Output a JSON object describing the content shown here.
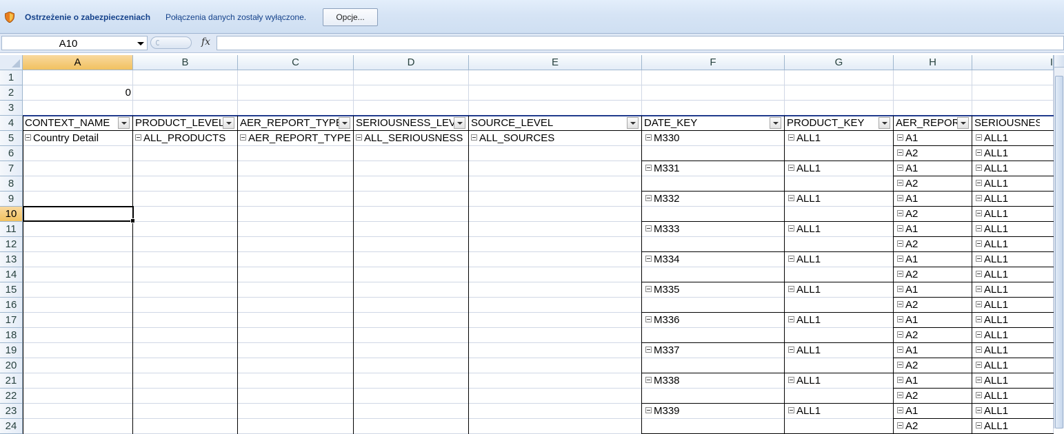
{
  "security_bar": {
    "title": "Ostrzeżenie o zabezpieczeniach",
    "message": "Połączenia danych zostały wyłączone.",
    "options_button": "Opcje..."
  },
  "formula_bar": {
    "name_box": "A10",
    "fx_label": "fx",
    "formula": ""
  },
  "columns": [
    "A",
    "B",
    "C",
    "D",
    "E",
    "F",
    "G",
    "H",
    "I"
  ],
  "rows": [
    "1",
    "2",
    "3",
    "4",
    "5",
    "6",
    "7",
    "8",
    "9",
    "10",
    "11",
    "12",
    "13",
    "14",
    "15",
    "16",
    "17",
    "18",
    "19",
    "20",
    "21",
    "22",
    "23",
    "24"
  ],
  "selected_cell": "A10",
  "cell_A2": "0",
  "pivot_headers": [
    "CONTEXT_NAME",
    "PRODUCT_LEVEL",
    "AER_REPORT_TYPE",
    "SERIOUSNESS_LEVEL",
    "SOURCE_LEVEL",
    "DATE_KEY",
    "PRODUCT_KEY",
    "AER_REPORT",
    "SERIOUSNESS"
  ],
  "row5": [
    "Country Detail",
    "ALL_PRODUCTS",
    "AER_REPORT_TYPE",
    "ALL_SERIOUSNESS",
    "ALL_SOURCES"
  ],
  "date_keys": [
    "M330",
    "M331",
    "M332",
    "M333",
    "M334",
    "M335",
    "M336",
    "M337",
    "M338",
    "M339"
  ],
  "product_key_value": "ALL1",
  "aer_report_values": [
    "A1",
    "A2"
  ],
  "seriousness_value": "ALL1",
  "colors": {
    "selected_header": "#f1c15f",
    "security_text": "#15428b",
    "gridline": "#d0d7e5"
  }
}
